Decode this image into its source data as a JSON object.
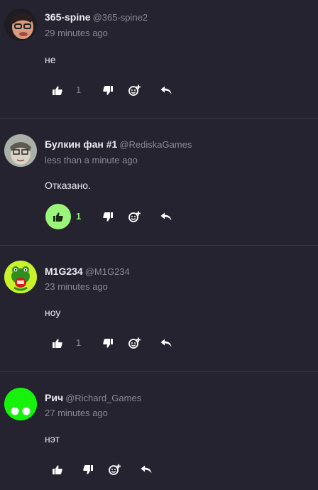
{
  "comments": [
    {
      "name": "365-spine",
      "handle": "@365-spine2",
      "time": "29 minutes ago",
      "text": "не",
      "likes": "1",
      "liked": false,
      "avatar_icon": "photo-avatar-icon"
    },
    {
      "name": "Булкин фан #1",
      "handle": "@RediskaGames",
      "time": "less than a minute ago",
      "text": "Отказано.",
      "likes": "1",
      "liked": true,
      "avatar_icon": "photo-avatar-icon"
    },
    {
      "name": "M1G234",
      "handle": "@M1G234",
      "time": "23 minutes ago",
      "text": "ноу",
      "likes": "1",
      "liked": false,
      "avatar_icon": "frog-avatar-icon"
    },
    {
      "name": "Рич",
      "handle": "@Richard_Games",
      "time": "27 minutes ago",
      "text": "нэт",
      "likes": "",
      "liked": false,
      "avatar_icon": "green-dots-avatar-icon"
    }
  ],
  "colors": {
    "background": "#25232f",
    "accent_green": "#9bf57a",
    "muted": "#8b8996"
  }
}
